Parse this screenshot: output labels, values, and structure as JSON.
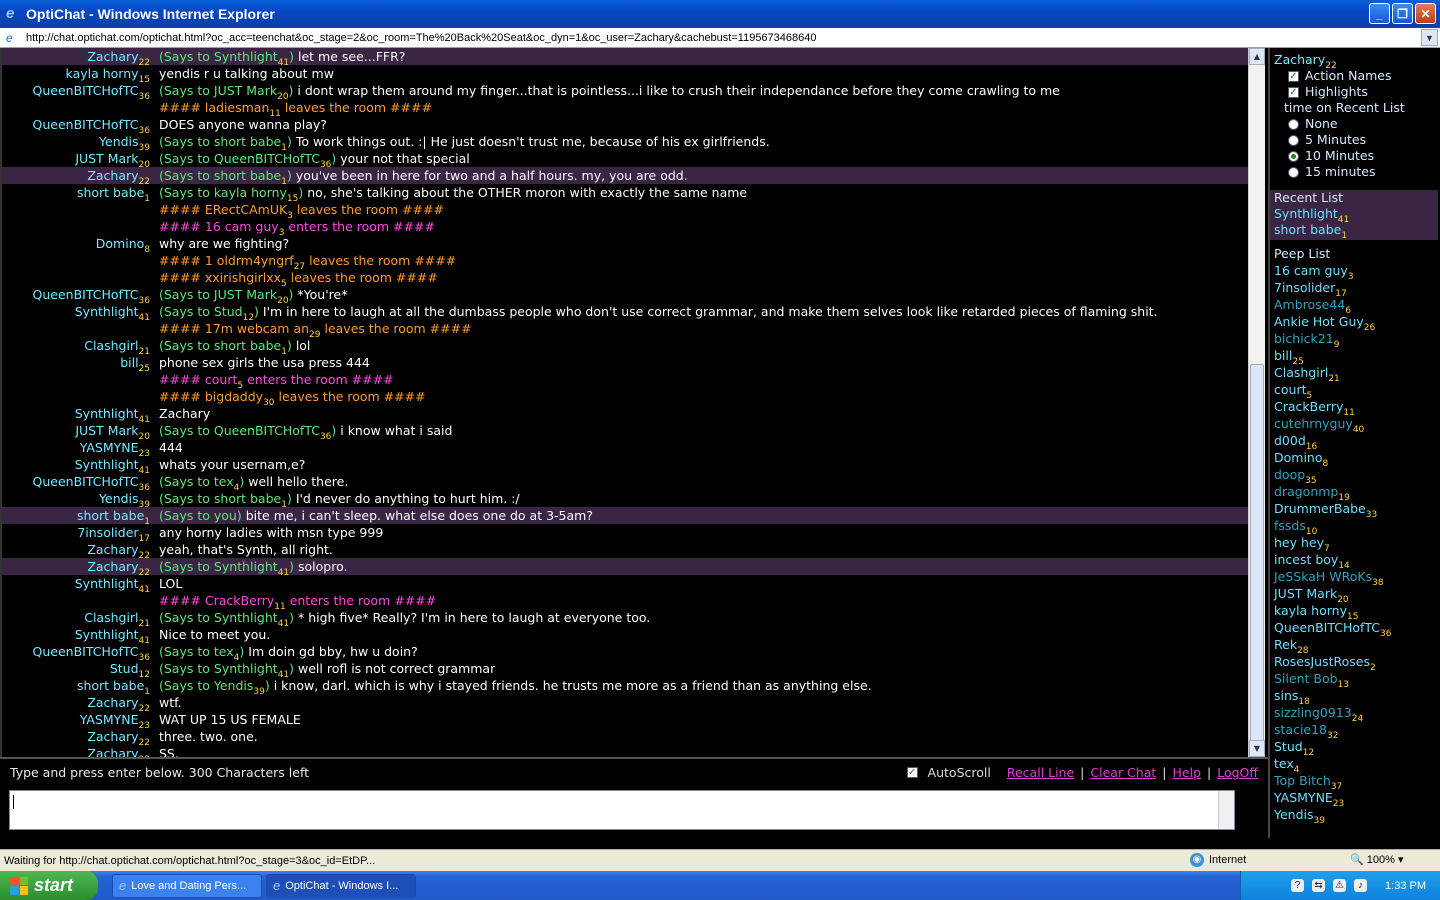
{
  "window": {
    "title": "OptiChat - Windows Internet Explorer"
  },
  "address": {
    "url": "http://chat.optichat.com/optichat.html?oc_acc=teenchat&oc_stage=2&oc_room=The%20Back%20Seat&oc_dyn=1&oc_user=Zachary&cachebust=1195673468640"
  },
  "chat": {
    "says_prefix": "(Says to ",
    "says_you": "(Says to you)",
    "rows": [
      {
        "name": "Zachary",
        "n": "22",
        "to": "Synthlight",
        "tn": "41",
        "msg": "let me see...FFR?",
        "hl": true
      },
      {
        "name": "kayla horny",
        "n": "15",
        "msg": "yendis r u talking about mw"
      },
      {
        "name": "QueenBITCHofTC",
        "n": "36",
        "to": "JUST Mark",
        "tn": "20",
        "msg": "i dont wrap them around my finger...that is pointless...i like to crush their independance before they come crawling to me"
      },
      {
        "sys": "leave",
        "who": "ladiesman",
        "wn": "11",
        "text": "leaves the room ####"
      },
      {
        "name": "QueenBITCHofTC",
        "n": "36",
        "msg": "DOES anyone wanna play?"
      },
      {
        "name": "Yendis",
        "n": "39",
        "to": "short babe",
        "tn": "1",
        "msg": "To work things out. :| He just doesn't trust me, because of his ex girlfriends."
      },
      {
        "name": "JUST Mark",
        "n": "20",
        "to": "QueenBITCHofTC",
        "tn": "36",
        "msg": "your not that special"
      },
      {
        "name": "Zachary",
        "n": "22",
        "to": "short babe",
        "tn": "1",
        "msg": "you've been in here for two and a half hours. my, you are odd.",
        "hl": true
      },
      {
        "name": "short babe",
        "n": "1",
        "to": "kayla horny",
        "tn": "15",
        "msg": "no, she's talking about the OTHER moron with exactly the same name"
      },
      {
        "sys": "leave",
        "who": "ERectCAmUK",
        "wn": "3",
        "text": "leaves the room ####"
      },
      {
        "sys": "enter",
        "who": "16 cam guy",
        "wn": "3",
        "text": "enters the room ####"
      },
      {
        "name": "Domino",
        "n": "8",
        "msg": "why are we fighting?"
      },
      {
        "sys": "leave",
        "who": "1 oldrm4yngrf",
        "wn": "27",
        "text": "leaves the room ####"
      },
      {
        "sys": "leave",
        "who": "xxirishgirlxx",
        "wn": "5",
        "text": "leaves the room ####"
      },
      {
        "name": "QueenBITCHofTC",
        "n": "36",
        "to": "JUST Mark",
        "tn": "20",
        "msg": "*You're*"
      },
      {
        "name": "Synthlight",
        "n": "41",
        "to": "Stud",
        "tn": "12",
        "msg": "I'm in here to laugh at all the dumbass people who don't use correct grammar, and make them selves look like retarded pieces of flaming shit."
      },
      {
        "sys": "leave",
        "who": "17m webcam an",
        "wn": "29",
        "text": "leaves the room ####"
      },
      {
        "name": "Clashgirl",
        "n": "21",
        "to": "short babe",
        "tn": "1",
        "msg": "lol"
      },
      {
        "name": "bill",
        "n": "25",
        "msg": "phone sex girls the usa press 444"
      },
      {
        "sys": "enter",
        "who": "court",
        "wn": "5",
        "text": "enters the room ####"
      },
      {
        "sys": "leave",
        "who": "bigdaddy",
        "wn": "30",
        "text": "leaves the room ####"
      },
      {
        "name": "Synthlight",
        "n": "41",
        "msg": "Zachary"
      },
      {
        "name": "JUST Mark",
        "n": "20",
        "to": "QueenBITCHofTC",
        "tn": "36",
        "msg": "i know what i said"
      },
      {
        "name": "YASMYNE",
        "n": "23",
        "msg": "444"
      },
      {
        "name": "Synthlight",
        "n": "41",
        "msg": "whats your usernam,e?"
      },
      {
        "name": "QueenBITCHofTC",
        "n": "36",
        "to": "tex",
        "tn": "4",
        "msg": "well hello there."
      },
      {
        "name": "Yendis",
        "n": "39",
        "to": "short babe",
        "tn": "1",
        "msg": "I'd never do anything to hurt him. :/"
      },
      {
        "name": "short babe",
        "n": "1",
        "you": true,
        "msg": "bite me, i can't sleep. what else does one do at 3-5am?",
        "hl": true
      },
      {
        "name": "7insolider",
        "n": "17",
        "msg": "any horny ladies with msn type 999"
      },
      {
        "name": "Zachary",
        "n": "22",
        "msg": "yeah, that's Synth, all right."
      },
      {
        "name": "Zachary",
        "n": "22",
        "to": "Synthlight",
        "tn": "41",
        "msg": "solopro.",
        "hl": true
      },
      {
        "name": "Synthlight",
        "n": "41",
        "msg": "LOL"
      },
      {
        "sys": "enter",
        "who": "CrackBerry",
        "wn": "11",
        "text": "enters the room ####"
      },
      {
        "name": "Clashgirl",
        "n": "21",
        "to": "Synthlight",
        "tn": "41",
        "msg": "* high five* Really? I'm in here to laugh at everyone too."
      },
      {
        "name": "Synthlight",
        "n": "41",
        "msg": "Nice to meet you."
      },
      {
        "name": "QueenBITCHofTC",
        "n": "36",
        "to": "tex",
        "tn": "4",
        "msg": "Im doin gd bby, hw u doin?"
      },
      {
        "name": "Stud",
        "n": "12",
        "to": "Synthlight",
        "tn": "41",
        "msg": "well rofl is not correct grammar"
      },
      {
        "name": "short babe",
        "n": "1",
        "to": "Yendis",
        "tn": "39",
        "msg": "i know, darl. which is why i stayed friends. he trusts me more as a friend than as anything else."
      },
      {
        "name": "Zachary",
        "n": "22",
        "msg": "wtf."
      },
      {
        "name": "YASMYNE",
        "n": "23",
        "msg": "WAT UP 15 US FEMALE"
      },
      {
        "name": "Zachary",
        "n": "22",
        "msg": "three. two. one."
      },
      {
        "name": "Zachary",
        "n": "22",
        "msg": "SS."
      }
    ]
  },
  "sidebar": {
    "user": "Zachary",
    "user_num": "22",
    "action_names": "Action Names",
    "highlights": "Highlights",
    "time_label": "time on Recent List",
    "radio": [
      "None",
      "5 Minutes",
      "10 Minutes",
      "15 minutes"
    ],
    "radio_selected": 2,
    "recent_title": "Recent List",
    "recent": [
      {
        "name": "Synthlight",
        "n": "41"
      },
      {
        "name": "short babe",
        "n": "1"
      }
    ],
    "peep_title": "Peep List",
    "peep": [
      {
        "name": "16 cam guy",
        "n": "3"
      },
      {
        "name": "7insolider",
        "n": "17"
      },
      {
        "name": "Ambrose44",
        "n": "6",
        "dim": true
      },
      {
        "name": "Ankie Hot Guy",
        "n": "26"
      },
      {
        "name": "bichick21",
        "n": "9",
        "dim": true
      },
      {
        "name": "bill",
        "n": "25"
      },
      {
        "name": "Clashgirl",
        "n": "21"
      },
      {
        "name": "court",
        "n": "5"
      },
      {
        "name": "CrackBerry",
        "n": "11"
      },
      {
        "name": "cutehrnyguy",
        "n": "40",
        "dim": true
      },
      {
        "name": "d00d",
        "n": "16"
      },
      {
        "name": "Domino",
        "n": "8"
      },
      {
        "name": "doop",
        "n": "35",
        "dim": true
      },
      {
        "name": "dragonmp",
        "n": "19",
        "dim": true
      },
      {
        "name": "DrummerBabe",
        "n": "33"
      },
      {
        "name": "fssds",
        "n": "10",
        "dim": true
      },
      {
        "name": "hey hey",
        "n": "7"
      },
      {
        "name": "incest boy",
        "n": "14"
      },
      {
        "name": "JeSSkaH WRoKs",
        "n": "38",
        "dim": true
      },
      {
        "name": "JUST Mark",
        "n": "20"
      },
      {
        "name": "kayla horny",
        "n": "15"
      },
      {
        "name": "QueenBITCHofTC",
        "n": "36"
      },
      {
        "name": "Rek",
        "n": "28"
      },
      {
        "name": "RosesJustRoses",
        "n": "2"
      },
      {
        "name": "Silent Bob",
        "n": "13",
        "dim": true
      },
      {
        "name": "sins",
        "n": "18"
      },
      {
        "name": "sizzling0913",
        "n": "24",
        "dim": true
      },
      {
        "name": "stacie18",
        "n": "32",
        "dim": true
      },
      {
        "name": "Stud",
        "n": "12"
      },
      {
        "name": "tex",
        "n": "4"
      },
      {
        "name": "Top Bitch",
        "n": "37",
        "dim": true
      },
      {
        "name": "YASMYNE",
        "n": "23"
      },
      {
        "name": "Yendis",
        "n": "39"
      }
    ]
  },
  "input": {
    "hint": "Type and press enter below.   300 Characters left",
    "autoscroll": "AutoScroll",
    "recall": "Recall Line",
    "clear": "Clear Chat",
    "help": "Help",
    "logoff": "LogOff",
    "sep": "|"
  },
  "status": {
    "text": "Waiting for http://chat.optichat.com/optichat.html?oc_stage=3&oc_id=EtDP...",
    "zone": "Internet",
    "zoom": "100%"
  },
  "taskbar": {
    "start": "start",
    "task1": "Love and Dating Pers...",
    "task2": "OptiChat - Windows I...",
    "clock": "1:33 PM"
  }
}
